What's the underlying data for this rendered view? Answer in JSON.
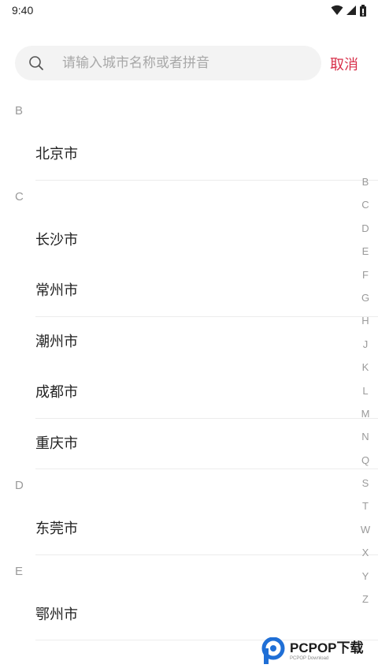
{
  "status_bar": {
    "time": "9:40",
    "icons": [
      "wifi-icon",
      "signal-icon",
      "battery-icon"
    ]
  },
  "search": {
    "placeholder": "请输入城市名称或者拼音",
    "value": "",
    "cancel_label": "取消"
  },
  "sections": [
    {
      "letter": "B",
      "cities": [
        "北京市"
      ]
    },
    {
      "letter": "C",
      "cities": [
        "长沙市",
        "常州市",
        "潮州市",
        "成都市",
        "重庆市"
      ]
    },
    {
      "letter": "D",
      "cities": [
        "东莞市"
      ]
    },
    {
      "letter": "E",
      "cities": [
        "鄂州市"
      ]
    }
  ],
  "index_letters": [
    "B",
    "C",
    "D",
    "E",
    "F",
    "G",
    "H",
    "J",
    "K",
    "L",
    "M",
    "N",
    "Q",
    "S",
    "T",
    "W",
    "X",
    "Y",
    "Z"
  ],
  "watermark": {
    "main": "PCPOP下载",
    "sub": "PCPOP Download"
  },
  "colors": {
    "accent": "#d8304a",
    "muted_text": "#9a9a9a",
    "search_bg": "#f3f3f3",
    "watermark_blue": "#1f6fd6"
  }
}
